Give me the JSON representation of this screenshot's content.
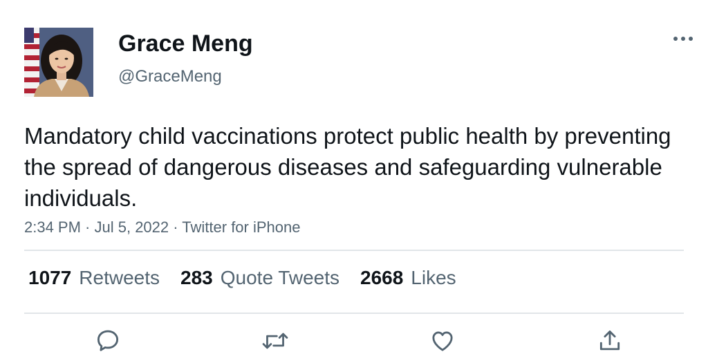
{
  "author": {
    "display_name": "Grace Meng",
    "handle": "@GraceMeng",
    "avatar_icon": "profile-photo"
  },
  "tweet": {
    "text": "Mandatory child vaccinations protect public health by preventing the spread of dangerous diseases and safeguarding vulnerable individuals.",
    "time": "2:34 PM",
    "date": "Jul 5, 2022",
    "source": "Twitter for iPhone",
    "separator": " · "
  },
  "stats": {
    "retweets": {
      "count": "1077",
      "label": "Retweets"
    },
    "quote_tweets": {
      "count": "283",
      "label": "Quote Tweets"
    },
    "likes": {
      "count": "2668",
      "label": "Likes"
    }
  },
  "actions": {
    "reply_icon": "reply-icon",
    "retweet_icon": "retweet-icon",
    "like_icon": "heart-icon",
    "share_icon": "share-icon",
    "more_icon": "more-icon"
  },
  "colors": {
    "text_primary": "#0f1419",
    "text_secondary": "#536471",
    "divider": "#e1e5e8",
    "icon": "#536471"
  }
}
